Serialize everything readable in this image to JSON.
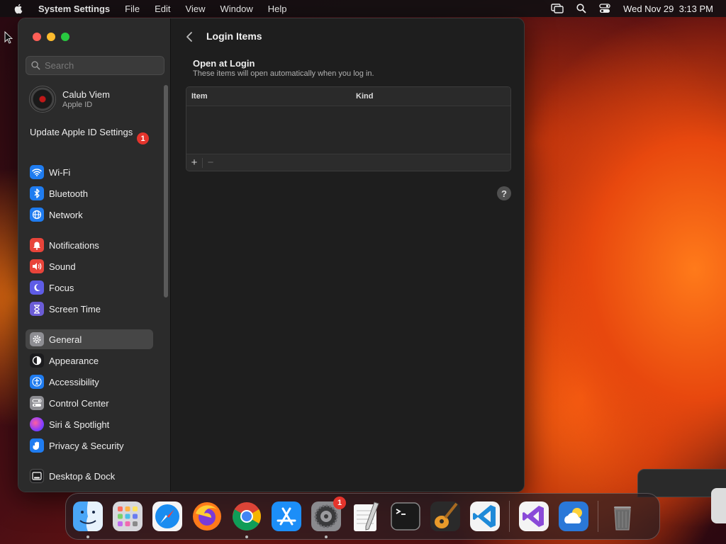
{
  "menubar": {
    "app_name": "System Settings",
    "menus": [
      "File",
      "Edit",
      "View",
      "Window",
      "Help"
    ],
    "datetime": "Wed Nov 29  3:13 PM"
  },
  "sidebar": {
    "search_placeholder": "Search",
    "account": {
      "name": "Calub Viem",
      "subtitle": "Apple ID"
    },
    "update": {
      "label": "Update Apple ID Settings",
      "badge": "1"
    },
    "items": [
      {
        "label": "Wi-Fi",
        "icon": "wifi-icon",
        "color": "#1f7cf0"
      },
      {
        "label": "Bluetooth",
        "icon": "bluetooth-icon",
        "color": "#1f7cf0"
      },
      {
        "label": "Network",
        "icon": "globe-icon",
        "color": "#1f7cf0"
      },
      {
        "label": "Notifications",
        "icon": "bell-icon",
        "color": "#e8443a"
      },
      {
        "label": "Sound",
        "icon": "speaker-icon",
        "color": "#e8443a"
      },
      {
        "label": "Focus",
        "icon": "moon-icon",
        "color": "#5e5ce6"
      },
      {
        "label": "Screen Time",
        "icon": "hourglass-icon",
        "color": "#6b5cd6"
      },
      {
        "label": "General",
        "icon": "gear-icon",
        "color": "#8e8e93",
        "active": true
      },
      {
        "label": "Appearance",
        "icon": "appearance-icon",
        "color": "#1c1c1e"
      },
      {
        "label": "Accessibility",
        "icon": "accessibility-icon",
        "color": "#1f7cf0"
      },
      {
        "label": "Control Center",
        "icon": "control-center-icon",
        "color": "#8e8e93"
      },
      {
        "label": "Siri & Spotlight",
        "icon": "siri-icon",
        "color": "#b040d0"
      },
      {
        "label": "Privacy & Security",
        "icon": "hand-icon",
        "color": "#1f7cf0"
      },
      {
        "label": "Desktop & Dock",
        "icon": "dock-icon",
        "color": "#1c1c1e"
      }
    ]
  },
  "main": {
    "title": "Login Items",
    "section_title": "Open at Login",
    "section_subtitle": "These items will open automatically when you log in.",
    "columns": [
      "Item",
      "Kind"
    ],
    "add_label": "+",
    "remove_label": "−",
    "help_label": "?"
  },
  "dock": {
    "apps": [
      {
        "name": "Finder",
        "icon": "finder-icon",
        "running": true
      },
      {
        "name": "Launchpad",
        "icon": "launchpad-icon"
      },
      {
        "name": "Safari",
        "icon": "safari-icon"
      },
      {
        "name": "Firefox",
        "icon": "firefox-icon"
      },
      {
        "name": "Chrome",
        "icon": "chrome-icon",
        "running": true
      },
      {
        "name": "App Store",
        "icon": "app-store-icon"
      },
      {
        "name": "System Settings",
        "icon": "system-settings-icon",
        "running": true,
        "badge": "1"
      },
      {
        "name": "TextEdit",
        "icon": "textedit-icon"
      },
      {
        "name": "Terminal",
        "icon": "terminal-icon"
      },
      {
        "name": "GarageBand",
        "icon": "garageband-icon"
      },
      {
        "name": "VS Code",
        "icon": "vscode-icon"
      },
      {
        "name": "Visual Studio",
        "icon": "visual-studio-icon"
      },
      {
        "name": "Weather",
        "icon": "weather-icon"
      },
      {
        "name": "Trash",
        "icon": "trash-icon"
      }
    ]
  }
}
